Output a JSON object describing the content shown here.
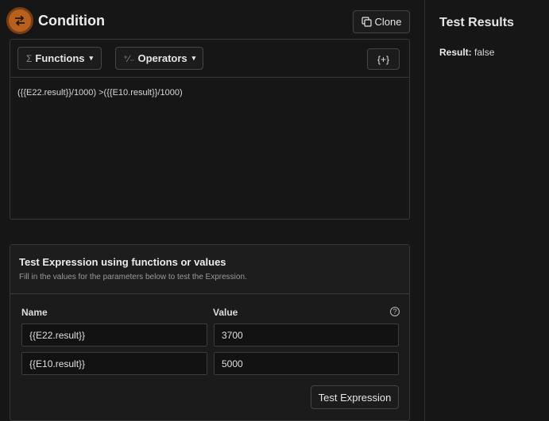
{
  "header": {
    "title": "Condition",
    "clone_label": "Clone"
  },
  "toolbar": {
    "functions_label": "Functions",
    "operators_label": "Operators",
    "variable_label": "{+}"
  },
  "editor": {
    "expression": "({{E22.result}}/1000) >({{E10.result}}/1000)"
  },
  "test_panel": {
    "title": "Test Expression using functions or values",
    "subtitle": "Fill in the values for the parameters below to test the Expression.",
    "col_name": "Name",
    "col_value": "Value",
    "rows": [
      {
        "name": "{{E22.result}}",
        "value": "3700"
      },
      {
        "name": "{{E10.result}}",
        "value": "5000"
      }
    ],
    "test_button": "Test Expression"
  },
  "results": {
    "title": "Test Results",
    "result_label": "Result:",
    "result_value": "false"
  },
  "colors": {
    "accent": "#b8611f",
    "background": "#161616"
  }
}
